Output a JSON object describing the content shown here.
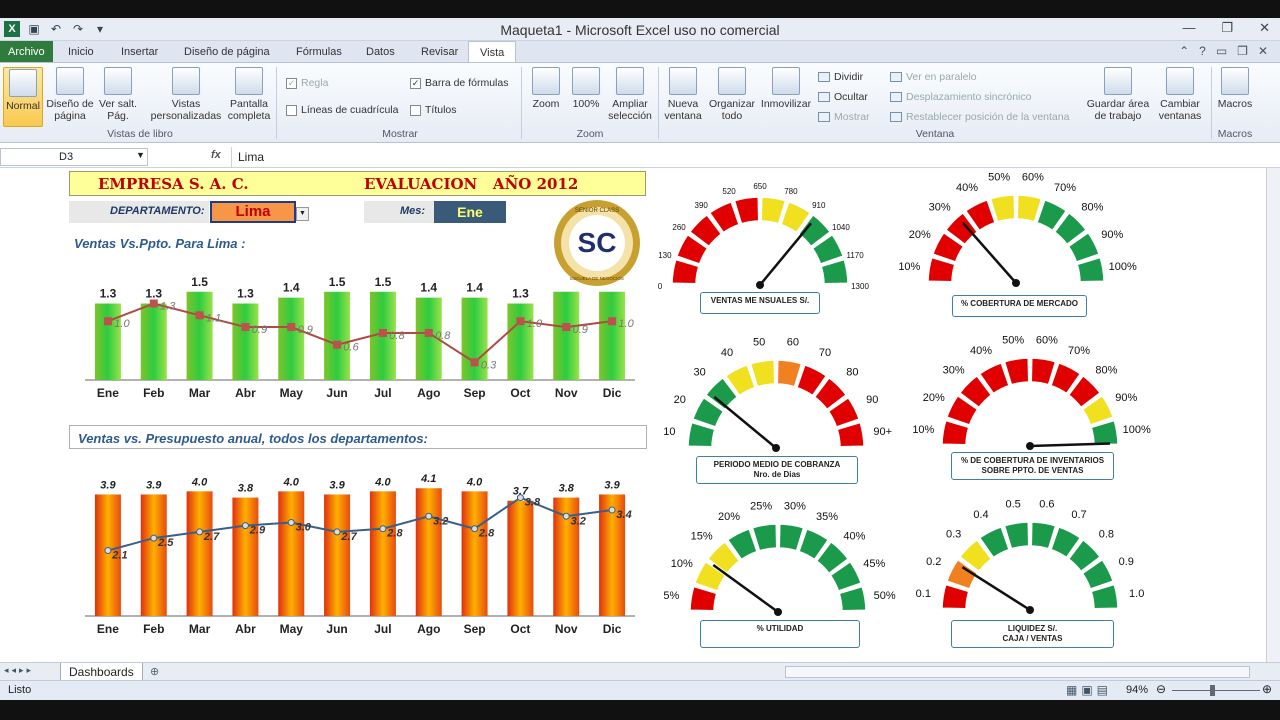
{
  "window": {
    "title": "Maqueta1 - Microsoft Excel uso no comercial"
  },
  "tabs": [
    "Archivo",
    "Inicio",
    "Insertar",
    "Diseño de página",
    "Fórmulas",
    "Datos",
    "Revisar",
    "Vista"
  ],
  "ribbon": {
    "views": {
      "normal": "Normal",
      "page_layout": "Diseño de página",
      "page_break": "Ver salt. Pág.",
      "custom": "Vistas personalizadas",
      "full": "Pantalla completa",
      "group": "Vistas de libro"
    },
    "show": {
      "ruler": "Regla",
      "gridlines": "Líneas de cuadrícula",
      "formula_bar": "Barra de fórmulas",
      "headings": "Títulos",
      "group": "Mostrar"
    },
    "zoom": {
      "zoom": "Zoom",
      "hundred": "100%",
      "fit": "Ampliar selección",
      "group": "Zoom"
    },
    "window": {
      "new": "Nueva ventana",
      "arrange": "Organizar todo",
      "freeze": "Inmovilizar",
      "split": "Dividir",
      "hide": "Ocultar",
      "show": "Mostrar",
      "side": "Ver en paralelo",
      "sync": "Desplazamiento sincrónico",
      "reset": "Restablecer posición de la ventana",
      "save": "Guardar área de trabajo",
      "switch": "Cambiar ventanas",
      "group": "Ventana"
    },
    "macros": {
      "label": "Macros",
      "group": "Macros"
    }
  },
  "formula_bar": {
    "cell": "D3",
    "fx": "fx",
    "value": "Lima"
  },
  "dashboard": {
    "company": "EMPRESA S. A. C.",
    "eval": "EVALUACION   AÑO 2012",
    "dept_label": "DEPARTAMENTO:",
    "dept_value": "Lima",
    "month_label": "Mes:",
    "month_value": "Ene",
    "chart1_title": "Ventas Vs.Ppto. Para Lima :",
    "chart2_title": "Ventas  vs. Presupuesto anual, todos los departamentos:"
  },
  "chart_data": [
    {
      "type": "bar",
      "title": "Ventas Vs.Ppto. Para Lima :",
      "categories": [
        "Ene",
        "Feb",
        "Mar",
        "Abr",
        "May",
        "Jun",
        "Jul",
        "Ago",
        "Sep",
        "Oct",
        "Nov",
        "Dic"
      ],
      "series": [
        {
          "values": [
            1.3,
            1.3,
            1.5,
            1.3,
            1.4,
            1.5,
            1.5,
            1.4,
            1.4,
            1.3,
            1.5,
            1.5
          ],
          "labels": [
            "1.3",
            "1.3",
            "1.5",
            "1.3",
            "1.4",
            "1.5",
            "1.5",
            "1.4",
            "1.4",
            "1.3",
            "",
            ""
          ]
        },
        {
          "type": "line",
          "values": [
            1.0,
            1.3,
            1.1,
            0.9,
            0.9,
            0.6,
            0.8,
            0.8,
            0.3,
            1.0,
            0.9,
            1.0
          ],
          "labels": [
            "1.0",
            "1.3",
            "1.1",
            "0.9",
            "0.9",
            "0.6",
            "0.8",
            "0.8",
            "0.3",
            "1.0",
            "0.9",
            "1.0"
          ]
        }
      ],
      "ylim": [
        0,
        1.7
      ]
    },
    {
      "type": "bar",
      "title": "Ventas  vs. Presupuesto anual, todos los departamentos:",
      "categories": [
        "Ene",
        "Feb",
        "Mar",
        "Abr",
        "May",
        "Jun",
        "Jul",
        "Ago",
        "Sep",
        "Oct",
        "Nov",
        "Dic"
      ],
      "series": [
        {
          "values": [
            3.9,
            3.9,
            4.0,
            3.8,
            4.0,
            3.9,
            4.0,
            4.1,
            4.0,
            3.7,
            3.8,
            3.9
          ],
          "labels": [
            "3.9",
            "3.9",
            "4.0",
            "3.8",
            "4.0",
            "3.9",
            "4.0",
            "4.1",
            "4.0",
            "3.7",
            "3.8",
            "3.9"
          ]
        },
        {
          "type": "line",
          "values": [
            2.1,
            2.5,
            2.7,
            2.9,
            3.0,
            2.7,
            2.8,
            3.2,
            2.8,
            3.8,
            3.2,
            3.4
          ],
          "labels": [
            "2.1",
            "2.5",
            "2.7",
            "2.9",
            "3.0",
            "2.7",
            "2.8",
            "3.2",
            "2.8",
            "3.8",
            "3.2",
            "3.4"
          ]
        }
      ],
      "ylim": [
        0,
        4.3
      ]
    }
  ],
  "gauges": [
    {
      "label": "VENTAS ME NSUALES S/.",
      "ticks": [
        "0",
        "130",
        "260",
        "390",
        "520",
        "650",
        "780",
        "910",
        "1040",
        "1170",
        "1300"
      ],
      "value": 0.72,
      "colors": [
        "r",
        "r",
        "r",
        "r",
        "r",
        "y",
        "y",
        "g",
        "g",
        "g"
      ]
    },
    {
      "label": "% COBERTURA DE MERCADO",
      "ticks": [
        "10%",
        "20%",
        "30%",
        "40%",
        "50%",
        "60%",
        "70%",
        "80%",
        "90%",
        "100%"
      ],
      "value": 0.27,
      "colors": [
        "r",
        "r",
        "r",
        "r",
        "y",
        "y",
        "g",
        "g",
        "g",
        "g"
      ]
    },
    {
      "label": "PERIODO  MEDIO DE COBRANZA\nNro. de Dias",
      "ticks": [
        "10",
        "20",
        "30",
        "40",
        "50",
        "60",
        "70",
        "80",
        "90",
        "90+"
      ],
      "value": 0.22,
      "colors": [
        "g",
        "g",
        "g",
        "y",
        "y",
        "o",
        "r",
        "r",
        "r",
        "r"
      ]
    },
    {
      "label": "% DE COBERTURA DE INVENTARIOS\nSOBRE PPTO. DE VENTAS",
      "ticks": [
        "10%",
        "20%",
        "30%",
        "40%",
        "50%",
        "60%",
        "70%",
        "80%",
        "90%",
        "100%"
      ],
      "value": 0.99,
      "colors": [
        "r",
        "r",
        "r",
        "r",
        "r",
        "r",
        "r",
        "r",
        "y",
        "g"
      ]
    },
    {
      "label": "%  UTILIDAD",
      "ticks": [
        "5%",
        "10%",
        "15%",
        "20%",
        "25%",
        "30%",
        "35%",
        "40%",
        "45%",
        "50%"
      ],
      "value": 0.2,
      "colors": [
        "r",
        "y",
        "y",
        "g",
        "g",
        "g",
        "g",
        "g",
        "g",
        "g"
      ]
    },
    {
      "label": "LIQUIDEZ     S/.\nCAJA / VENTAS",
      "ticks": [
        "0.1",
        "0.2",
        "0.3",
        "0.4",
        "0.5",
        "0.6",
        "0.7",
        "0.8",
        "0.9",
        "1.0"
      ],
      "value": 0.18,
      "colors": [
        "r",
        "o",
        "y",
        "g",
        "g",
        "g",
        "g",
        "g",
        "g",
        "g"
      ]
    }
  ],
  "logo": {
    "text": "SENIOR CLASS",
    "sub": "ESCUELA DE NEGOCIOS",
    "mono": "SC"
  },
  "sheet_tab": "Dashboards",
  "status": {
    "ready": "Listo",
    "zoom": "94%"
  }
}
